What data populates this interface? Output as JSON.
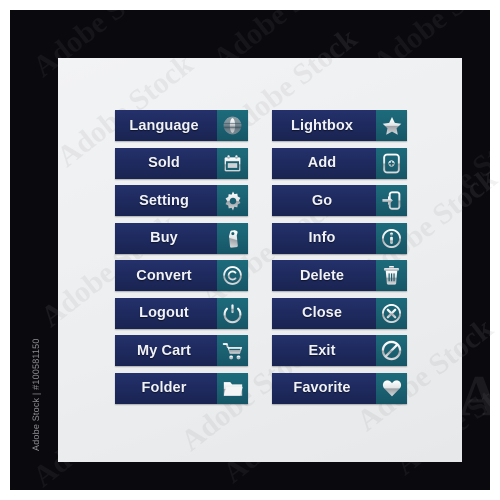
{
  "theme": {
    "frame_color": "#0a0a0e",
    "panel_color": "#eceef0",
    "button_color": "#1e2a5e",
    "icon_panel_color": "#1a6071",
    "label_color": "#f0f2f7",
    "icon_color": "#ffffff"
  },
  "buttons": {
    "left_column": [
      {
        "label": "Language",
        "icon": "globe-icon"
      },
      {
        "label": "Sold",
        "icon": "calendar-icon"
      },
      {
        "label": "Setting",
        "icon": "gear-icon"
      },
      {
        "label": "Buy",
        "icon": "price-tag-icon"
      },
      {
        "label": "Convert",
        "icon": "copyright-icon"
      },
      {
        "label": "Logout",
        "icon": "power-icon"
      },
      {
        "label": "My Cart",
        "icon": "shopping-cart-icon"
      },
      {
        "label": "Folder",
        "icon": "folder-icon"
      }
    ],
    "right_column": [
      {
        "label": "Lightbox",
        "icon": "star-icon"
      },
      {
        "label": "Add",
        "icon": "add-box-icon"
      },
      {
        "label": "Go",
        "icon": "login-arrow-icon"
      },
      {
        "label": "Info",
        "icon": "info-circle-icon"
      },
      {
        "label": "Delete",
        "icon": "trash-icon"
      },
      {
        "label": "Close",
        "icon": "close-circle-icon"
      },
      {
        "label": "Exit",
        "icon": "prohibited-icon"
      },
      {
        "label": "Favorite",
        "icon": "heart-icon"
      }
    ]
  },
  "watermarks": {
    "tiles": [
      "Adobe Stock",
      "Adobe Stock",
      "Adobe Stock",
      "Adobe Stock",
      "Adobe Stock",
      "Adobe Stock",
      "Adobe Stock",
      "Adobe Stock",
      "Adobe Stock"
    ],
    "credit_line": "Adobe Stock | #100581150",
    "corner_glyph": "A"
  }
}
